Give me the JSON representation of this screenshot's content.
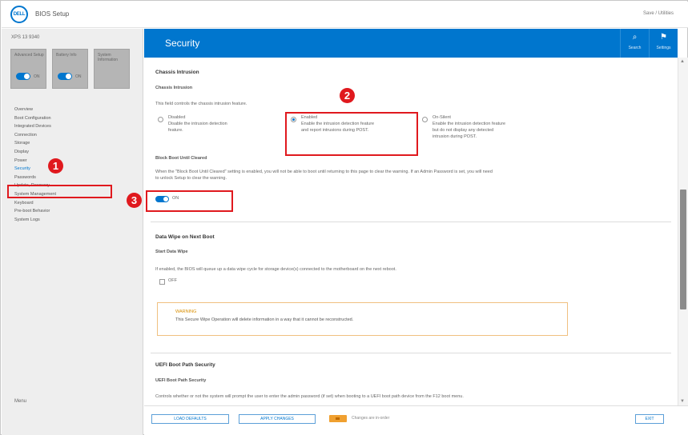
{
  "app": {
    "logo": "DELL",
    "title": "BIOS Setup",
    "top_right": "Save / Utilities"
  },
  "sidebar": {
    "system_label": "XPS 13 9340",
    "cards": [
      {
        "label": "Advanced Setup",
        "toggle_label": "ON"
      },
      {
        "label": "Battery Info",
        "toggle_label": "ON"
      },
      {
        "label": "System Information",
        "toggle_label": ""
      }
    ],
    "items": [
      {
        "label": "Overview"
      },
      {
        "label": "Boot Configuration"
      },
      {
        "label": "Integrated Devices"
      },
      {
        "label": "Connection"
      },
      {
        "label": "Storage"
      },
      {
        "label": "Display"
      },
      {
        "label": "Power"
      },
      {
        "label": "Security"
      },
      {
        "label": "Passwords"
      },
      {
        "label": "Update, Recovery"
      },
      {
        "label": "System Management"
      },
      {
        "label": "Keyboard"
      },
      {
        "label": "Pre-boot Behavior"
      },
      {
        "label": "System Logs"
      }
    ],
    "footer_label": "Menu"
  },
  "header": {
    "title": "Security",
    "buttons": [
      {
        "glyph": "⌕",
        "label": "Search",
        "icon": "search-icon"
      },
      {
        "glyph": "⚑",
        "label": "Settings",
        "icon": "settings-icon"
      }
    ]
  },
  "content": {
    "chassis": {
      "title": "Chassis Intrusion",
      "subtitle": "Chassis Intrusion",
      "description": "This field controls the chassis intrusion feature.",
      "options": [
        {
          "label": "Disabled",
          "desc1": "Disable the intrusion detection",
          "desc2": "feature.",
          "selected": false
        },
        {
          "label": "Enabled",
          "desc1": "Enable the intrusion detection feature",
          "desc2": "and report intrusions during POST.",
          "selected": true
        },
        {
          "label": "On-Silent",
          "desc1": "Enable the intrusion detection feature",
          "desc2": "but do not display any detected",
          "desc3": "intrusion during POST.",
          "selected": false
        }
      ]
    },
    "block_boot": {
      "title": "Block Boot Until Cleared",
      "description1": "When the \"Block Boot Until Cleared\" setting is enabled, you will not be able to boot until returning to this page to clear the warning. If an Admin Password is set, you will need",
      "description2": "to unlock Setup to clear the warning.",
      "toggle_label": "ON"
    },
    "data_wipe": {
      "title": "Data Wipe on Next Boot",
      "subtitle": "Start Data Wipe",
      "description": "If enabled, the BIOS will queue up a data wipe cycle for storage device(s) connected to the motherboard on the next reboot.",
      "checkbox_label": "OFF",
      "warning_title": "WARNING",
      "warning_text": "This Secure Wipe Operation will delete information in a way that it cannot be reconstructed."
    },
    "uefi": {
      "title": "UEFI Boot Path Security",
      "subtitle": "UEFI Boot Path Security",
      "description": "Controls whether or not the system will prompt the user to enter the admin password (if set) when booting to a UEFI boot path device from the F12 boot menu."
    }
  },
  "footer": {
    "btn_load_defaults": "LOAD DEFAULTS",
    "btn_apply": "APPLY CHANGES",
    "hint": "Changes are in-order",
    "btn_exit": "EXIT"
  },
  "annotations": [
    "1",
    "2",
    "3"
  ],
  "colors": {
    "accent": "#0076ce",
    "annotation": "#e0191e",
    "warning": "#f0a030"
  }
}
